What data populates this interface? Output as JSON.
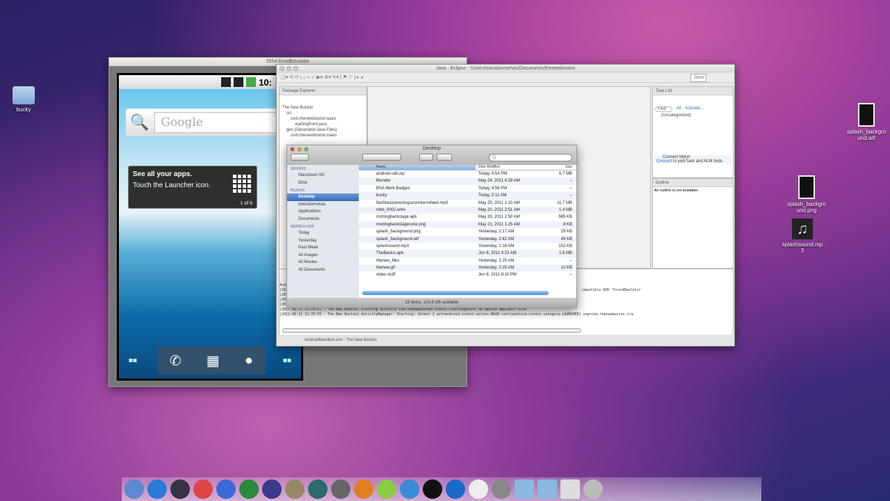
{
  "desktop": {
    "icons_left": [
      {
        "label": "bucky"
      }
    ],
    "icons_right": [
      {
        "label": "splash_background.wif"
      },
      {
        "label": "splash_background.png"
      },
      {
        "label": "splashsound.mp3"
      }
    ]
  },
  "emulator": {
    "title": "5554:DroidEmulator",
    "clock": "10:",
    "search_placeholder": "Google",
    "tip_title": "See all your apps.",
    "tip_text": "Touch the Launcher icon.",
    "tip_page": "1 of 6"
  },
  "eclipse": {
    "title": "Java - Eclipse - /Users/travisbornehas/Documents/thenewboston",
    "perspective": "Java",
    "package_explorer_tab": "Package Explorer",
    "tree": [
      "The New Boston",
      "src",
      "com.thenewboston.lauro",
      "startingPoint.java",
      "gen [Generated Java Files]",
      "com.thenewboston.travis"
    ],
    "task_list_tab": "Task List",
    "task_find": "Find",
    "task_all": "All",
    "task_activate": "Activate...",
    "task_category": "(Uncategorized)",
    "mylyn_title": "Connect Mylyn",
    "mylyn_link": "Connect",
    "mylyn_text": "to your task and ALM tools.",
    "outline_tab": "Outline",
    "outline_text": "An outline is not available.",
    "console": [
      "Andro",
      "[20",
      "[20",
      "[20",
      "[20",
      "[2011-06-11 22:70:51 - The New Boston] Starting activity com.thenewboston.travis.startingPoint on device emulator-5554",
      "[2011-06-11 22:70:55 - The New Boston] ActivityManager: Starting: Intent { act=android.intent.action.MAIN cat=[android.intent.category.LAUNCHER] cmp=com.thenewboston.tra"
    ],
    "console_right": "ompatible AVD 'DroidEmulator'",
    "status": "AndroidManifest.xml - The New Boston"
  },
  "finder": {
    "title": "Desktop",
    "search_placeholder": "Q",
    "sections": [
      {
        "heading": "DEVICES",
        "items": [
          "Macintosh HD",
          "iDisk"
        ]
      },
      {
        "heading": "PLACES",
        "items": [
          "Desktop",
          "travisbornehas",
          "Applications",
          "Documents"
        ]
      },
      {
        "heading": "SEARCH FOR",
        "items": [
          "Today",
          "Yesterday",
          "Past Week",
          "All Images",
          "All Movies",
          "All Documents"
        ]
      }
    ],
    "selected": "Desktop",
    "columns": [
      "Name",
      "Date Modified",
      "Size"
    ],
    "rows": [
      [
        "android-sdk.zip",
        "Today, 4:54 PM",
        "6.7 MB"
      ],
      [
        "Blender",
        "May 24, 2011 4:28 AM",
        "--"
      ],
      [
        "BSA Merit Badges",
        "Today, 4:56 PM",
        "--"
      ],
      [
        "bucky",
        "Today, 5:11 AM",
        "--"
      ],
      [
        "flashbasiceventsguccionlarsnfeed.mp3",
        "May 25, 2011 1:10 AM",
        "11.7 MB"
      ],
      [
        "mbb_0002.wmv",
        "May 20, 2011 2:51 AM",
        "1.4 MB"
      ],
      [
        "mstringbackstage.apk",
        "May 20, 2011 2:50 AM",
        "585 KB"
      ],
      [
        "mstringbackstagecolor.png",
        "May 21, 2011 1:25 AM",
        "8 KB"
      ],
      [
        "splash_background.png",
        "Yesterday, 2:17 AM",
        "29 KB"
      ],
      [
        "splash_background.wif",
        "Yesterday, 2:42 AM",
        "49 KB"
      ],
      [
        "splashsound.mp3",
        "Yesterday, 2:18 AM",
        "152 KB"
      ],
      [
        "TheBasics.apk",
        "Jun 8, 2011 4:23 AM",
        "1.6 MB"
      ],
      [
        "thenew_files",
        "Yesterday, 2:25 AM",
        "--"
      ],
      [
        "thenew.gif",
        "Yesterday, 2:25 AM",
        "12 KB"
      ],
      [
        "video stuff",
        "Jun 8, 2011 8:10 PM",
        "--"
      ]
    ],
    "status": "15 items, 103.8 GB available"
  },
  "dock": [
    "finder",
    "app-store",
    "webcam",
    "chrome",
    "itunes",
    "photo-booth",
    "eclipse",
    "gimp",
    "time-machine",
    "screenshot",
    "blender",
    "android",
    "safari",
    "terminal",
    "quicktime",
    "x11",
    "preview",
    "applications-folder",
    "documents-folder",
    "downloads",
    "trash"
  ]
}
